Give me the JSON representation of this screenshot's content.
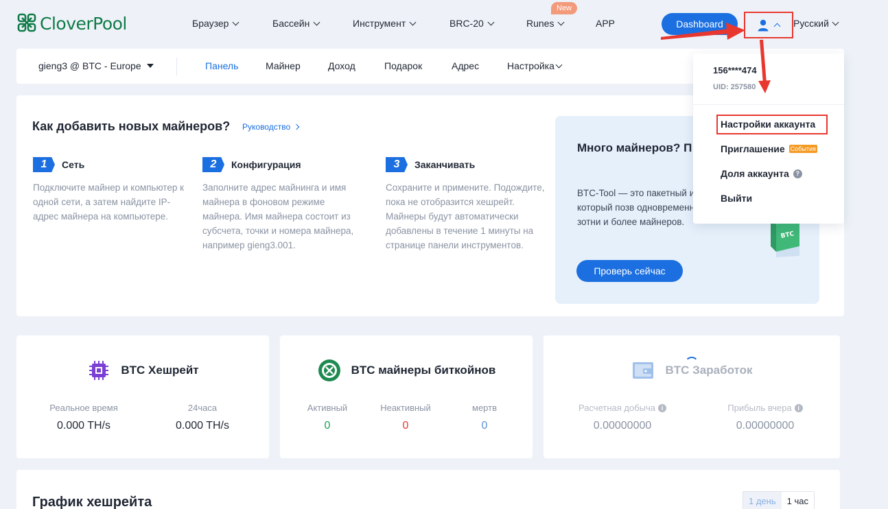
{
  "brand": {
    "name": "CloverPool"
  },
  "topnav": {
    "items": [
      {
        "label": "Браузер"
      },
      {
        "label": "Бассейн"
      },
      {
        "label": "Инструмент"
      },
      {
        "label": "BRC-20"
      },
      {
        "label": "Runes"
      },
      {
        "label": "APP"
      }
    ],
    "new_badge": "New",
    "dashboard": "Dashboard",
    "language": "Русский"
  },
  "subnav": {
    "account": "gieng3 @ BTC - Europe",
    "items": [
      {
        "label": "Панель"
      },
      {
        "label": "Майнер"
      },
      {
        "label": "Доход"
      },
      {
        "label": "Подарок"
      },
      {
        "label": "Адрес"
      },
      {
        "label": "Настройка"
      }
    ]
  },
  "guide": {
    "title": "Как добавить новых майнеров?",
    "link": "Руководство",
    "steps": [
      {
        "num": "1",
        "title": "Сеть",
        "desc": "Подключите майнер и компьютер к одной сети, а затем найдите IP-адрес майнера на компьютере."
      },
      {
        "num": "2",
        "title": "Конфигурация",
        "desc": "Заполните адрес майнинга и имя майнера в фоновом режиме майнера. Имя майнера состоит из субсчета, точки и номера майнера, например gieng3.001."
      },
      {
        "num": "3",
        "title": "Заканчивать",
        "desc": "Сохраните и примените. Подождите, пока не отобразится хешрейт. Майнеры будут автоматически добавлены в течение 1 минуты на странице панели инструментов."
      }
    ],
    "promo": {
      "title": "Много майнеров? П Tool",
      "desc": "BTC-Tool — это пакетный инструмент, который позв одновременно добавлять зотни и более майнеров.",
      "button": "Проверь сейчас",
      "box_label": "BTC Tool"
    }
  },
  "stats": {
    "hashrate": {
      "title": "BTC Хешрейт",
      "metrics": [
        {
          "label": "Реальное время",
          "value": "0.000 TH/s"
        },
        {
          "label": "24часа",
          "value": "0.000 TH/s"
        }
      ]
    },
    "miners": {
      "title": "BTC майнеры биткойнов",
      "metrics": [
        {
          "label": "Активный",
          "value": "0"
        },
        {
          "label": "Неактивный",
          "value": "0"
        },
        {
          "label": "мертв",
          "value": "0"
        }
      ]
    },
    "earnings": {
      "title": "BTC Заработок",
      "metrics": [
        {
          "label": "Расчетная добыча",
          "value": "0.00000000"
        },
        {
          "label": "Прибыль вчера",
          "value": "0.00000000"
        }
      ]
    }
  },
  "chart": {
    "title": "График хешрейта",
    "ranges": [
      "1 день",
      "1 час"
    ]
  },
  "account_menu": {
    "phone": "156****474",
    "uid": "UID: 257580",
    "items": [
      {
        "label": "Настройки аккаунта"
      },
      {
        "label": "Приглашение",
        "badge": "События"
      },
      {
        "label": "Доля аккаунта"
      },
      {
        "label": "Выйти"
      }
    ]
  },
  "colors": {
    "accent": "#1b6fe0",
    "brand": "#0f7a47",
    "annotation": "#e8372f",
    "active": "#18a058"
  }
}
